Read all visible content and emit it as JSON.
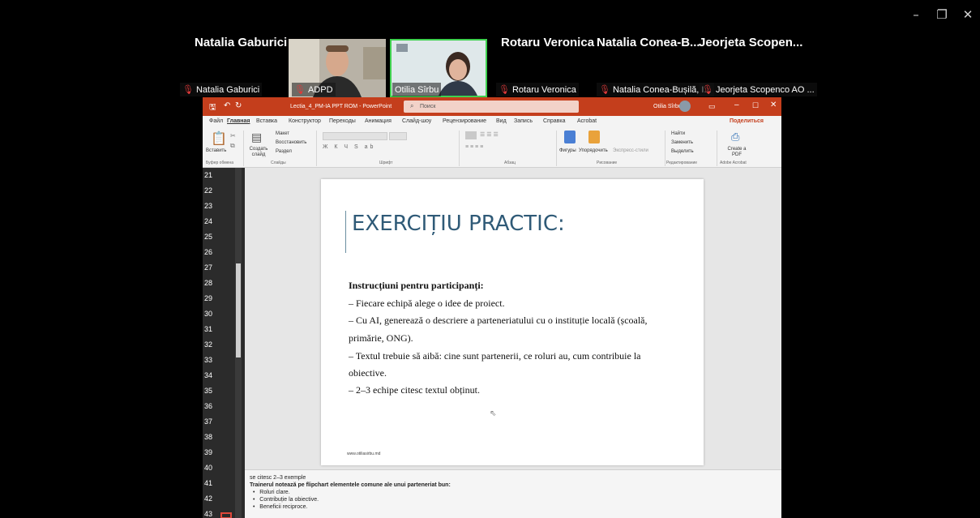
{
  "window_controls": {
    "minimize": "–",
    "restore": "❐",
    "close": "✕"
  },
  "participants": {
    "top_names": [
      "Natalia Gaburici",
      "Rotaru Veronica",
      "Natalia Conea-B...",
      "Jeorjeta Scopen..."
    ],
    "tags": [
      "Natalia Gaburici",
      "ADPD",
      "Otilia Sîrbu",
      "Rotaru Veronica",
      "Natalia Conea-Bușilă, I...",
      "Jeorjeta Scopenco AO ..."
    ]
  },
  "ppt": {
    "doc_title": "Lectia_4_PM-IA PPT ROM - PowerPoint",
    "search_placeholder": "Поиск",
    "user": "Otilia Sîrbu",
    "tabs": [
      "Файл",
      "Главная",
      "Вставка",
      "Конструктор",
      "Переходы",
      "Анимация",
      "Слайд-шоу",
      "Рецензирование",
      "Вид",
      "Запись",
      "Справка",
      "Acrobat"
    ],
    "share": "Поделиться",
    "ribbon": {
      "paste": "Вставить",
      "create_slide": "Создать слайд",
      "layout": "Макет",
      "reset": "Восстановить",
      "section": "Раздел",
      "shapes": "Фигуры",
      "arrange": "Упорядочить",
      "express_styles": "Экспресс-стили",
      "find": "Найти",
      "replace": "Заменить",
      "select": "Выделить",
      "create_pdf": "Create a PDF",
      "groups": [
        "Буфер обмена",
        "Слайды",
        "Шрифт",
        "Абзац",
        "Рисование",
        "Редактирование",
        "Adobe Acrobat"
      ]
    },
    "thumb_numbers": [
      "21",
      "22",
      "23",
      "24",
      "25",
      "26",
      "27",
      "28",
      "29",
      "30",
      "31",
      "32",
      "33",
      "34",
      "35",
      "36",
      "37",
      "38",
      "39",
      "40",
      "41",
      "42",
      "43"
    ],
    "slide": {
      "title": "EXERCIȚIU PRACTIC:",
      "heading": "Instrucțiuni pentru participanți:",
      "lines": [
        "– Fiecare echipă alege o idee de proiect.",
        "– Cu AI, generează o descriere a parteneriatului cu o instituție locală (școală,",
        "primărie, ONG).",
        "– Textul trebuie să aibă: cine sunt partenerii, ce roluri au, cum contribuie la",
        "obiective.",
        "– 2–3 echipe citesc textul obținut."
      ],
      "footer": "www.otiliasirbu.md"
    },
    "notes": {
      "line1": "se citesc 2–3 exemple",
      "line2": "Trainerul notează pe flipchart elementele comune ale unui parteneriat bun:",
      "bullets": [
        "Roluri clare.",
        "Contribuție la obiective.",
        "Beneficii reciproce."
      ]
    }
  }
}
